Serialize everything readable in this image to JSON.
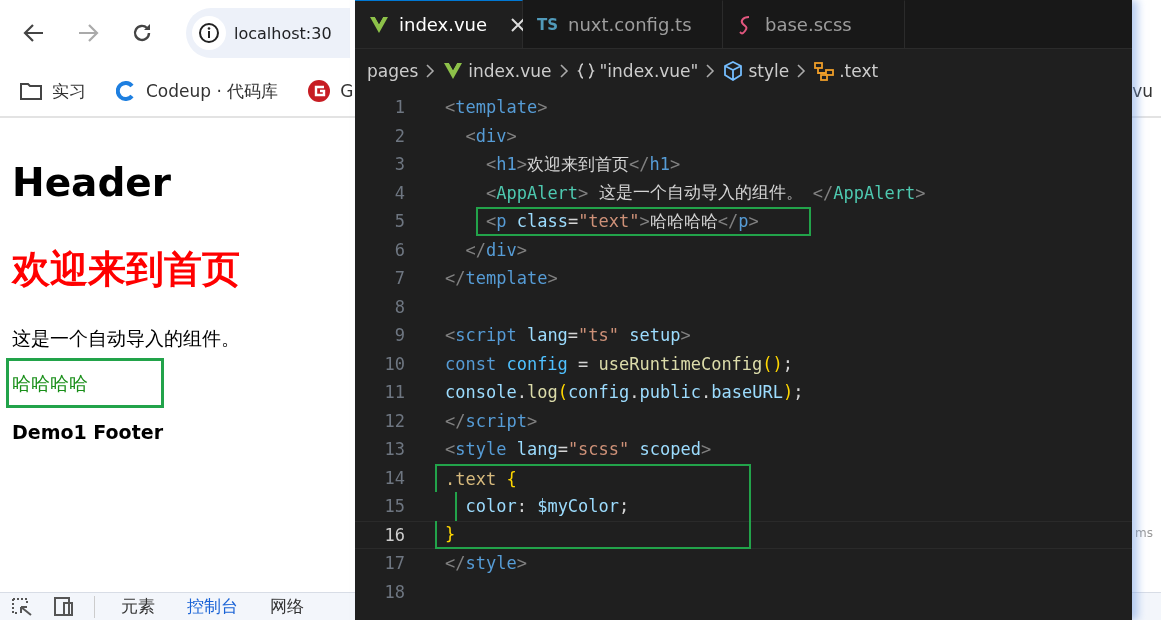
{
  "browser": {
    "address": "localhost:30",
    "bookmarks": [
      {
        "kind": "folder",
        "label": "实习"
      },
      {
        "kind": "codeup",
        "label": "Codeup · 代码库"
      },
      {
        "kind": "gitee",
        "label": "G"
      },
      {
        "kind": "plain",
        "label": "vu"
      }
    ],
    "page": [
      {
        "kind": "header",
        "text": "Header",
        "boxed": false
      },
      {
        "kind": "title",
        "text": "欢迎来到首页",
        "boxed": false
      },
      {
        "kind": "body",
        "text": "这是一个自动导入的组件。",
        "boxed": false
      },
      {
        "kind": "green",
        "text": "哈哈哈哈",
        "boxed": true
      },
      {
        "kind": "footer",
        "text": "Demo1 Footer",
        "boxed": false
      }
    ],
    "side_fragment": "ms",
    "devtools_tabs": [
      {
        "label": "元素",
        "selected": false
      },
      {
        "label": "控制台",
        "selected": true
      },
      {
        "label": "网络",
        "selected": false
      }
    ]
  },
  "editor": {
    "tabs": [
      {
        "kind": "vue",
        "label": "index.vue",
        "selected": true
      },
      {
        "kind": "ts",
        "badge": "TS",
        "label": "nuxt.config.ts",
        "selected": false
      },
      {
        "kind": "scss",
        "label": "base.scss",
        "selected": false
      }
    ],
    "breadcrumbs": [
      {
        "kind": "plain",
        "label": "pages"
      },
      {
        "kind": "vue",
        "label": "index.vue"
      },
      {
        "kind": "braces",
        "label": "\"index.vue\""
      },
      {
        "kind": "cube",
        "label": "style"
      },
      {
        "kind": "selector",
        "label": ".text"
      }
    ],
    "lines": [
      {
        "number": "1",
        "current": false,
        "boxed": false,
        "tokens": [
          {
            "kind": "p",
            "text": "<"
          },
          {
            "kind": "tag",
            "text": "template"
          },
          {
            "kind": "p",
            "text": ">"
          }
        ]
      },
      {
        "number": "2",
        "current": false,
        "boxed": false,
        "tokens": [
          {
            "kind": "p",
            "text": "  <"
          },
          {
            "kind": "tag",
            "text": "div"
          },
          {
            "kind": "p",
            "text": ">"
          }
        ]
      },
      {
        "number": "3",
        "current": false,
        "boxed": false,
        "tokens": [
          {
            "kind": "p",
            "text": "    <"
          },
          {
            "kind": "tag",
            "text": "h1"
          },
          {
            "kind": "p",
            "text": ">"
          },
          {
            "kind": "txt",
            "text": "欢迎来到首页"
          },
          {
            "kind": "p",
            "text": "</"
          },
          {
            "kind": "tag",
            "text": "h1"
          },
          {
            "kind": "p",
            "text": ">"
          }
        ]
      },
      {
        "number": "4",
        "current": false,
        "boxed": false,
        "tokens": [
          {
            "kind": "p",
            "text": "    <"
          },
          {
            "kind": "comp",
            "text": "AppAlert"
          },
          {
            "kind": "p",
            "text": ">"
          },
          {
            "kind": "txt",
            "text": " 这是一个自动导入的组件。 "
          },
          {
            "kind": "p",
            "text": "</"
          },
          {
            "kind": "comp",
            "text": "AppAlert"
          },
          {
            "kind": "p",
            "text": ">"
          }
        ]
      },
      {
        "number": "5",
        "current": false,
        "boxed": true,
        "tokens": [
          {
            "kind": "p",
            "text": "    <"
          },
          {
            "kind": "tag",
            "text": "p"
          },
          {
            "kind": "attr",
            "text": " class"
          },
          {
            "kind": "txt",
            "text": "="
          },
          {
            "kind": "str",
            "text": "\"text\""
          },
          {
            "kind": "p",
            "text": ">"
          },
          {
            "kind": "txt",
            "text": "哈哈哈哈"
          },
          {
            "kind": "p",
            "text": "</"
          },
          {
            "kind": "tag",
            "text": "p"
          },
          {
            "kind": "p",
            "text": ">"
          }
        ]
      },
      {
        "number": "6",
        "current": false,
        "boxed": false,
        "tokens": [
          {
            "kind": "p",
            "text": "  </"
          },
          {
            "kind": "tag",
            "text": "div"
          },
          {
            "kind": "p",
            "text": ">"
          }
        ]
      },
      {
        "number": "7",
        "current": false,
        "boxed": false,
        "tokens": [
          {
            "kind": "p",
            "text": "</"
          },
          {
            "kind": "tag",
            "text": "template"
          },
          {
            "kind": "p",
            "text": ">"
          }
        ]
      },
      {
        "number": "8",
        "current": false,
        "boxed": false
      },
      {
        "number": "9",
        "current": false,
        "boxed": false,
        "tokens": [
          {
            "kind": "p",
            "text": "<"
          },
          {
            "kind": "tag",
            "text": "script"
          },
          {
            "kind": "attr",
            "text": " lang"
          },
          {
            "kind": "txt",
            "text": "="
          },
          {
            "kind": "str",
            "text": "\"ts\""
          },
          {
            "kind": "attr",
            "text": " setup"
          },
          {
            "kind": "p",
            "text": ">"
          }
        ]
      },
      {
        "number": "10",
        "current": false,
        "boxed": false,
        "tokens": [
          {
            "kind": "kw",
            "text": "const"
          },
          {
            "kind": "var",
            "text": " config"
          },
          {
            "kind": "txt",
            "text": " = "
          },
          {
            "kind": "fn",
            "text": "useRuntimeConfig"
          },
          {
            "kind": "paren",
            "text": "()"
          },
          {
            "kind": "txt",
            "text": ";"
          }
        ]
      },
      {
        "number": "11",
        "current": false,
        "boxed": false,
        "tokens": [
          {
            "kind": "attr",
            "text": "console"
          },
          {
            "kind": "txt",
            "text": "."
          },
          {
            "kind": "fn",
            "text": "log"
          },
          {
            "kind": "paren",
            "text": "("
          },
          {
            "kind": "attr",
            "text": "config"
          },
          {
            "kind": "txt",
            "text": "."
          },
          {
            "kind": "attr",
            "text": "public"
          },
          {
            "kind": "txt",
            "text": "."
          },
          {
            "kind": "attr",
            "text": "baseURL"
          },
          {
            "kind": "paren",
            "text": ")"
          },
          {
            "kind": "txt",
            "text": ";"
          }
        ]
      },
      {
        "number": "12",
        "current": false,
        "boxed": false,
        "tokens": [
          {
            "kind": "p",
            "text": "</"
          },
          {
            "kind": "tag",
            "text": "script"
          },
          {
            "kind": "p",
            "text": ">"
          }
        ]
      },
      {
        "number": "13",
        "current": false,
        "boxed": false,
        "tokens": [
          {
            "kind": "p",
            "text": "<"
          },
          {
            "kind": "tag",
            "text": "style"
          },
          {
            "kind": "attr",
            "text": " lang"
          },
          {
            "kind": "txt",
            "text": "="
          },
          {
            "kind": "str",
            "text": "\"scss\""
          },
          {
            "kind": "attr",
            "text": " scoped"
          },
          {
            "kind": "p",
            "text": ">"
          }
        ]
      },
      {
        "number": "14",
        "current": false,
        "boxed": true,
        "tokens": [
          {
            "kind": "sel",
            "text": ".text"
          },
          {
            "kind": "paren",
            "text": " {"
          }
        ]
      },
      {
        "number": "15",
        "current": false,
        "boxed": true,
        "tokens": [
          {
            "kind": "attr",
            "text": "  color"
          },
          {
            "kind": "txt",
            "text": ": "
          },
          {
            "kind": "attr",
            "text": "$myColor"
          },
          {
            "kind": "txt",
            "text": ";"
          }
        ]
      },
      {
        "number": "16",
        "current": true,
        "boxed": true,
        "tokens": [
          {
            "kind": "paren",
            "text": "}"
          }
        ]
      },
      {
        "number": "17",
        "current": false,
        "boxed": false,
        "tokens": [
          {
            "kind": "p",
            "text": "</"
          },
          {
            "kind": "tag",
            "text": "style"
          },
          {
            "kind": "p",
            "text": ">"
          }
        ]
      },
      {
        "number": "18",
        "current": false,
        "boxed": false
      }
    ]
  }
}
